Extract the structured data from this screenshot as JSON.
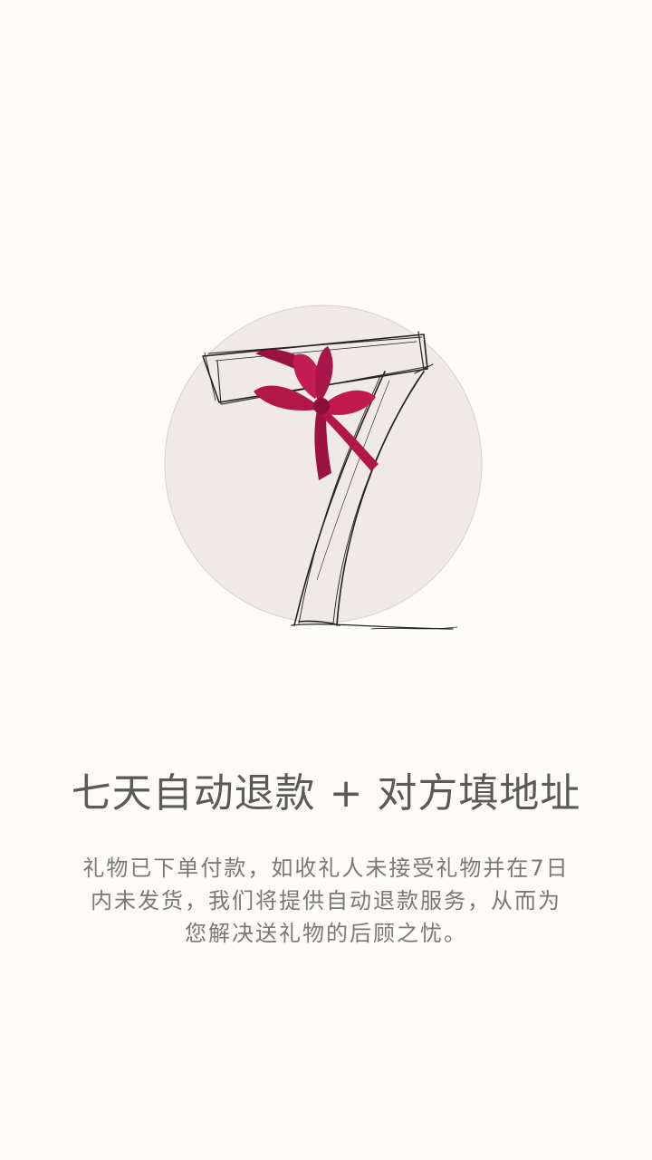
{
  "intro": {
    "headline": "七天自动退款 + 对方填地址",
    "description_lines": [
      "礼物已下单付款，如收礼人未接受礼物并在7日",
      "内未发货，我们将提供自动退款服务，从而为",
      "您解决送礼物的后顾之忧。"
    ]
  },
  "illustration": {
    "icon": "seven-with-ribbon-bow",
    "circle_color": "#efe9e8",
    "sketch_color": "#222222",
    "ribbon_color": "#b3174a"
  }
}
